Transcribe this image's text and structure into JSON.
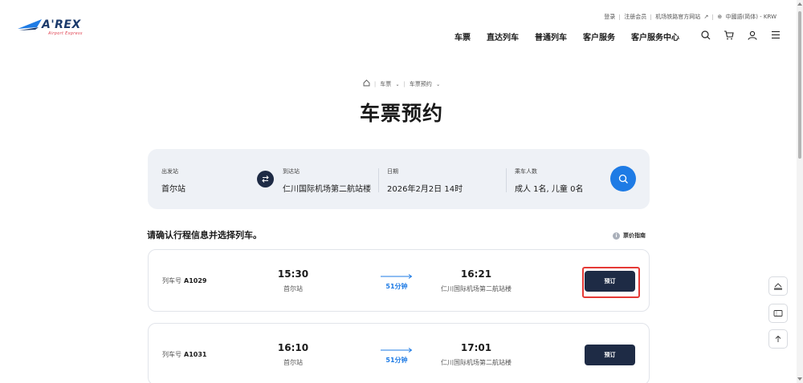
{
  "header": {
    "logo_text": "A'REX",
    "logo_sub": "Airport Express",
    "util": {
      "login": "登录",
      "register": "注册会员",
      "official_site": "机场铁路官方网站",
      "language": "中國語(简体) - KRW"
    },
    "nav": [
      "车票",
      "直达列车",
      "普通列车",
      "客户服务",
      "客户服务中心"
    ],
    "icons": [
      "search-icon",
      "cart-icon",
      "user-icon",
      "menu-icon"
    ]
  },
  "breadcrumb": {
    "home_icon": "home-icon",
    "items": [
      "车票",
      "车票预约"
    ]
  },
  "page_title": "车票预约",
  "search": {
    "departure": {
      "label": "出发站",
      "value": "首尔站"
    },
    "arrival": {
      "label": "到达站",
      "value": "仁川国际机场第二航站楼"
    },
    "date": {
      "label": "日期",
      "value": "2026年2月2日 14时"
    },
    "passengers": {
      "label": "乘车人数",
      "value": "成人 1名, 儿童 0名"
    }
  },
  "results": {
    "title": "请确认行程信息并选择列车。",
    "fare_guide": "票价指南",
    "trains": [
      {
        "no_label": "列车号",
        "no": "A1029",
        "dep_time": "15:30",
        "dep_station": "首尔站",
        "duration": "51分钟",
        "arr_time": "16:21",
        "arr_station": "仁川国际机场第二航站楼",
        "book_label": "预订"
      },
      {
        "no_label": "列车号",
        "no": "A1031",
        "dep_time": "16:10",
        "dep_station": "首尔站",
        "duration": "51分钟",
        "arr_time": "17:01",
        "arr_station": "仁川国际机场第二航站楼",
        "book_label": "预订"
      }
    ]
  },
  "side_buttons": [
    "ticket-check-icon",
    "ticket-icon",
    "arrow-up-icon"
  ],
  "colors": {
    "navy": "#1e2b45",
    "accent_blue": "#1e7be5",
    "highlight_red": "#e53935",
    "panel_bg": "#eef1f6"
  }
}
